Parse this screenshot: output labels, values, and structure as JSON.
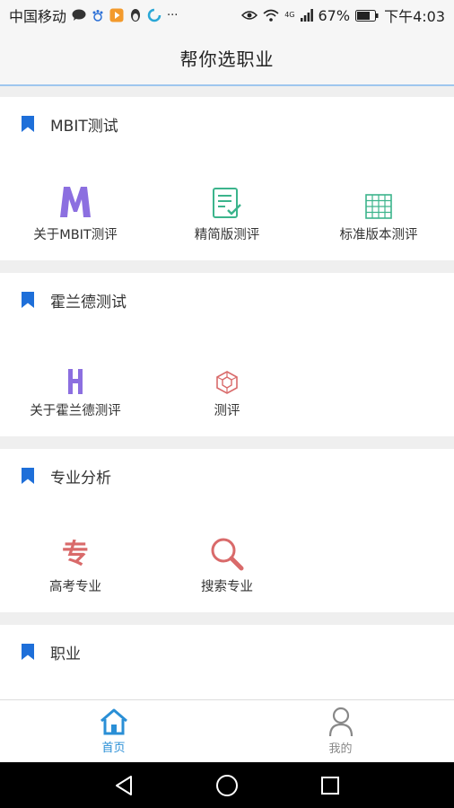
{
  "status_bar": {
    "carrier": "中国移动",
    "more": "···",
    "network": "4G",
    "battery": "67%",
    "time": "下午4:03"
  },
  "header": {
    "title": "帮你选职业"
  },
  "sections": [
    {
      "title": "MBIT测试",
      "items": [
        {
          "label": "关于MBIT测评",
          "icon": "letter-m-icon"
        },
        {
          "label": "精简版测评",
          "icon": "checklist-icon"
        },
        {
          "label": "标准版本测评",
          "icon": "grid-table-icon"
        }
      ]
    },
    {
      "title": "霍兰德测试",
      "items": [
        {
          "label": "关于霍兰德测评",
          "icon": "letter-h-icon"
        },
        {
          "label": "测评",
          "icon": "hexagon-icon"
        }
      ]
    },
    {
      "title": "专业分析",
      "items": [
        {
          "label": "高考专业",
          "icon": "zhuan-char-icon",
          "glyph": "专"
        },
        {
          "label": "搜索专业",
          "icon": "search-icon"
        }
      ]
    },
    {
      "title": "职业",
      "items": []
    }
  ],
  "tabbar": {
    "tabs": [
      {
        "label": "首页",
        "icon": "home-icon",
        "active": true
      },
      {
        "label": "我的",
        "icon": "person-icon",
        "active": false
      }
    ]
  },
  "colors": {
    "accent": "#2a8fd6",
    "bookmark": "#1e6fd9",
    "mbit": "#8c6fe0",
    "green": "#3cb48c",
    "red": "#d96a6a"
  }
}
